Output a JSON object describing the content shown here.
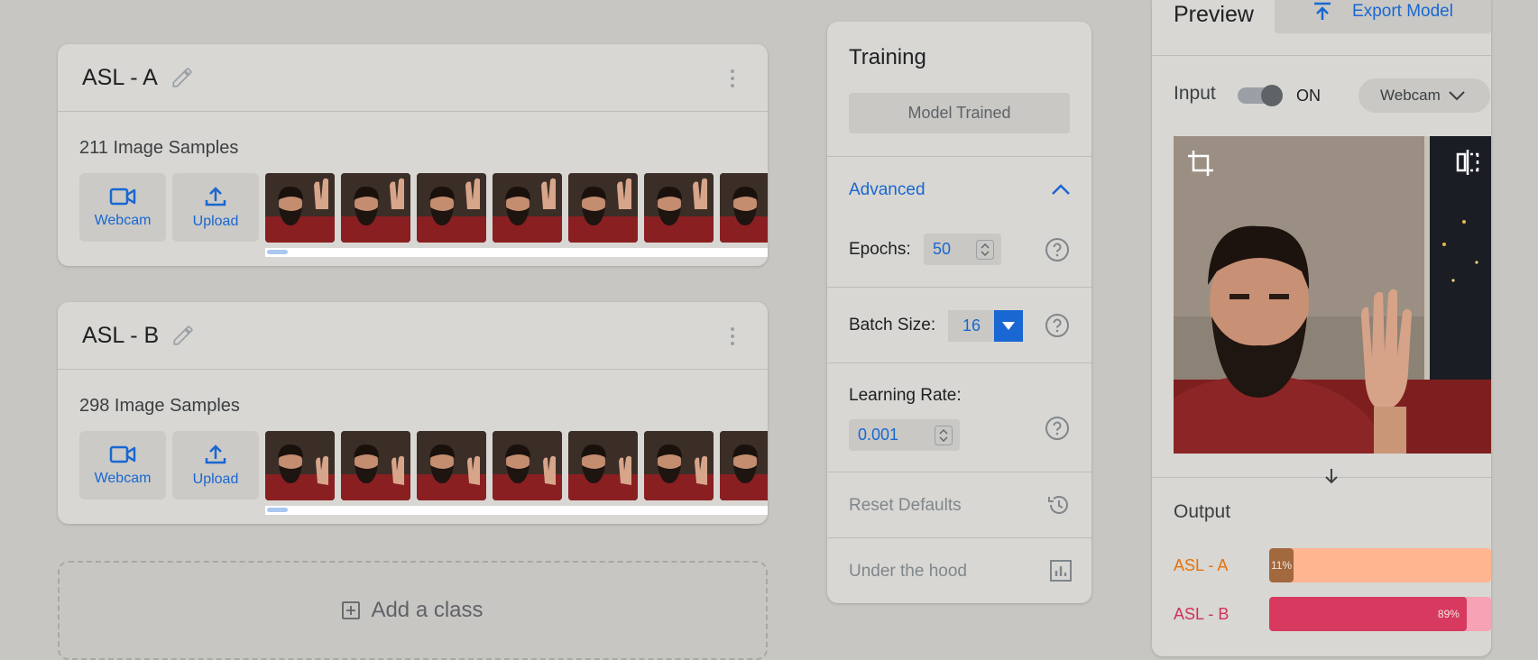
{
  "classes": [
    {
      "name": "ASL - A",
      "samples": "211 Image Samples",
      "webcam_label": "Webcam",
      "upload_label": "Upload",
      "thumb_count": 7
    },
    {
      "name": "ASL - B",
      "samples": "298 Image Samples",
      "webcam_label": "Webcam",
      "upload_label": "Upload",
      "thumb_count": 7
    }
  ],
  "add_class_label": "Add a class",
  "training": {
    "title": "Training",
    "status_button": "Model Trained",
    "advanced_label": "Advanced",
    "epochs_label": "Epochs:",
    "epochs_value": "50",
    "batch_label": "Batch Size:",
    "batch_value": "16",
    "lr_label": "Learning Rate:",
    "lr_value": "0.001",
    "reset_label": "Reset Defaults",
    "hood_label": "Under the hood"
  },
  "preview": {
    "title": "Preview",
    "export_label": "Export Model",
    "input_label": "Input",
    "toggle_state": "ON",
    "source_label": "Webcam",
    "output_label": "Output",
    "outputs": [
      {
        "name": "ASL - A",
        "percent_label": "11%",
        "value": 0.11,
        "color": "#e8710a",
        "track": "#ffb590",
        "fill": "#a2683e"
      },
      {
        "name": "ASL - B",
        "percent_label": "89%",
        "value": 0.89,
        "color": "#d0315b",
        "track": "#f7a2b5",
        "fill": "#d7395f"
      }
    ]
  },
  "colors": {
    "accent": "#1967d2",
    "background": "#c8c6c2",
    "card": "#d8d7d3"
  }
}
